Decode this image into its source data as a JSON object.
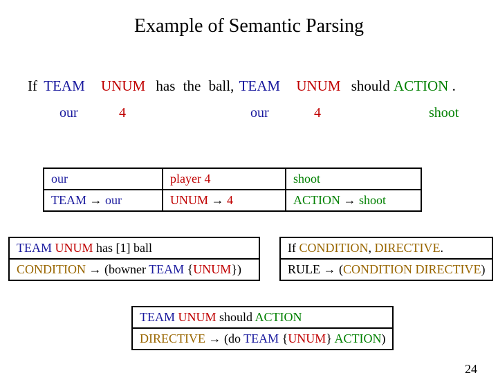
{
  "title": "Example of Semantic Parsing",
  "sentence": {
    "if": "If",
    "team": "TEAM",
    "unum": "UNUM",
    "has": "has",
    "the": "the",
    "ball": "ball,",
    "team2": "TEAM",
    "unum2": "UNUM",
    "should": "should",
    "action": "ACTION",
    "dot": "."
  },
  "subs": {
    "our1": "our",
    "four1": "4",
    "our2": "our",
    "four2": "4",
    "shoot": "shoot"
  },
  "t1": {
    "r1c1": "our",
    "r1c2": "player 4",
    "r1c3": "shoot",
    "r2c1_a": "TEAM",
    "r2c1_b": "our",
    "r2c2_a": "UNUM",
    "r2c2_b": "4",
    "r2c3_a": "ACTION",
    "r2c3_b": "shoot"
  },
  "t2l": {
    "r1_a": "TEAM",
    "r1_b": "UNUM",
    "r1_c": "has",
    "r1_d": "[1]",
    "r1_e": "ball",
    "r2_a": "CONDITION",
    "r2_b": "(bowner",
    "r2_c": "TEAM",
    "r2_d": "{",
    "r2_e": "UNUM",
    "r2_f": "})"
  },
  "t2r": {
    "r1_a": "If",
    "r1_b": "CONDITION",
    "r1_c": ",",
    "r1_d": "DIRECTIVE",
    "r1_e": ".",
    "r2_a": "RULE",
    "r2_b": "(",
    "r2_c": "CONDITION",
    "r2_d": "DIRECTIVE",
    "r2_e": ")"
  },
  "t3": {
    "r1_a": "TEAM",
    "r1_b": "UNUM",
    "r1_c": "should",
    "r1_d": "ACTION",
    "r2_a": "DIRECTIVE",
    "r2_b": "(do",
    "r2_c": "TEAM",
    "r2_d": "{",
    "r2_e": "UNUM",
    "r2_f": "}",
    "r2_g": "ACTION",
    "r2_h": ")"
  },
  "arrow": "→",
  "page": "24"
}
